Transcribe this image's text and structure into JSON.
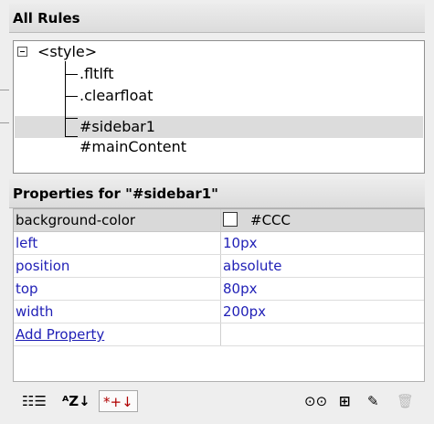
{
  "rules_header": "All Rules",
  "tree": {
    "root": "<style>",
    "children": [
      ".fltlft",
      ".clearfloat",
      "#sidebar1",
      "#mainContent"
    ],
    "selected_index": 2
  },
  "properties_header": "Properties for \"#sidebar1\"",
  "properties": [
    {
      "name": "background-color",
      "value": "#CCC"
    },
    {
      "name": "left",
      "value": "10px"
    },
    {
      "name": "position",
      "value": "absolute"
    },
    {
      "name": "top",
      "value": "80px"
    },
    {
      "name": "width",
      "value": "200px"
    }
  ],
  "add_property_label": "Add Property",
  "toolbar": {
    "category_view_icon": "☷☰",
    "alpha_view_icon": "ᴬZ↓",
    "set_properties_icon": "*+↓",
    "attach_stylesheet_icon": "⊙⊙",
    "new_rule_icon": "⊞",
    "edit_icon": "✎",
    "delete_icon": "🗑"
  },
  "colors": {
    "link": "#1f1fb6",
    "header_bg": "#e2e2e2",
    "selected_row": "#dcdcdc"
  }
}
